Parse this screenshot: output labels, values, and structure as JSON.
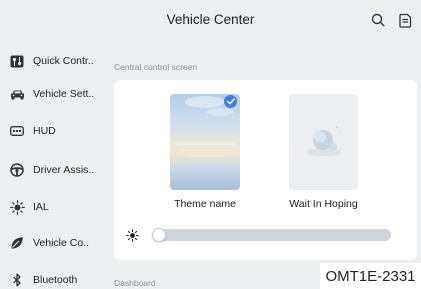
{
  "header": {
    "title": "Vehicle Center"
  },
  "icons": {
    "search": "search-icon",
    "document": "document-icon"
  },
  "sidebar": {
    "items": [
      {
        "label": "Quick Contr..",
        "icon": "quick-control-icon"
      },
      {
        "label": "Vehicle Sett..",
        "icon": "car-icon"
      },
      {
        "label": "HUD",
        "icon": "hud-icon"
      },
      {
        "label": "Driver Assis..",
        "icon": "steering-wheel-icon"
      },
      {
        "label": "IAL",
        "icon": "ambient-light-icon"
      },
      {
        "label": "Vehicle Co..",
        "icon": "leaf-icon"
      },
      {
        "label": "Bluetooth",
        "icon": "bluetooth-icon"
      }
    ]
  },
  "main": {
    "section_label": "Central control screen",
    "themes": [
      {
        "name": "Theme name",
        "selected": true
      },
      {
        "name": "Wait In Hoping",
        "selected": false
      }
    ],
    "brightness": {
      "icon": "brightness-sun-icon",
      "value": 0.02
    },
    "next_section_label": "Dashboard"
  },
  "watermark": "OMT1E-2331",
  "colors": {
    "background": "#eeeff1",
    "card": "#ffffff",
    "accent": "#3f7fe0",
    "slider_track": "#cfd5db"
  }
}
